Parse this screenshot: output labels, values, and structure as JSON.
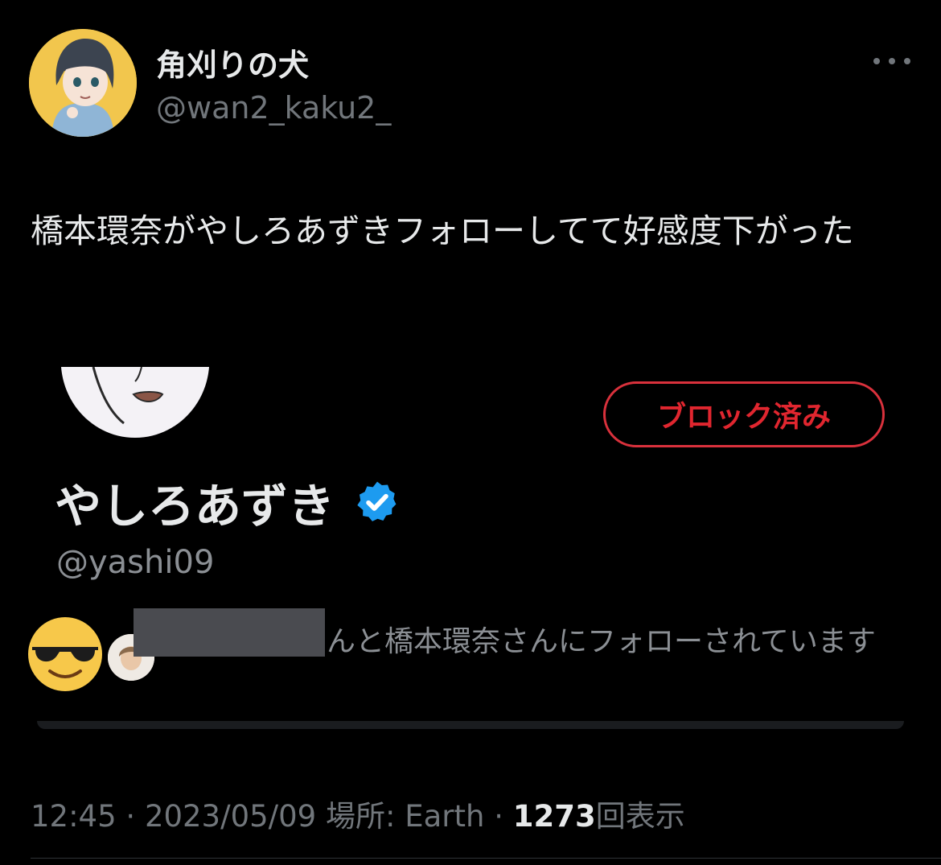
{
  "tweet": {
    "author_name": "角刈りの犬",
    "author_handle": "@wan2_kaku2_",
    "text": "橋本環奈がやしろあずきフォローしてて好感度下がった",
    "more_icon": "more-icon"
  },
  "embedded_profile": {
    "name": "やしろあずき",
    "handle": "@yashi09",
    "blocked_label": "ブロック済み",
    "verified_icon": "verified-badge-icon",
    "followed_by_text": "んと橋本環奈さんにフォローされています",
    "colors": {
      "blocked": "#e0262f",
      "verified": "#1d9bf0"
    }
  },
  "meta": {
    "time": "12:45",
    "separator": "·",
    "date": "2023/05/09",
    "location": "場所: Earth",
    "views_count": "1273",
    "views_label": "回表示"
  }
}
